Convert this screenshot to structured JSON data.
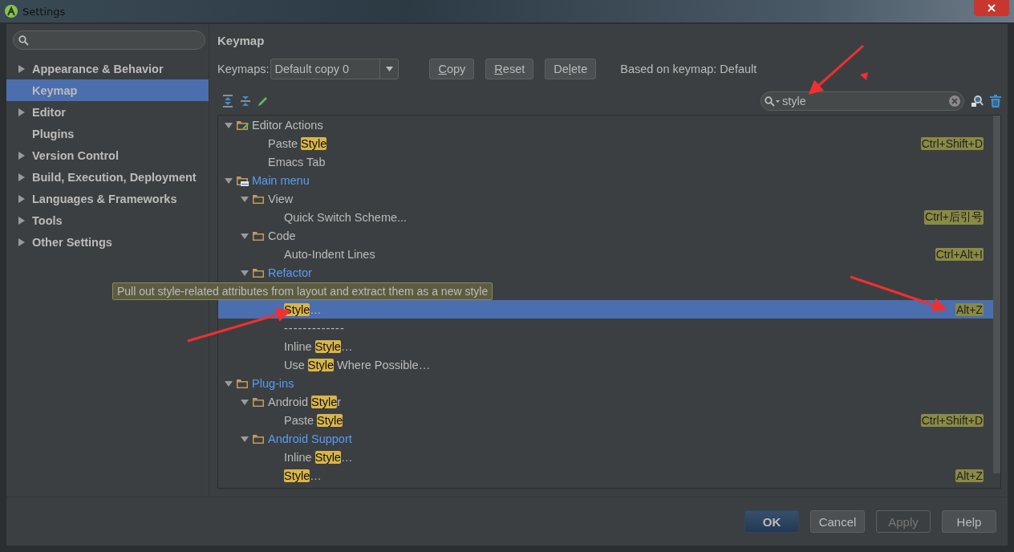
{
  "window": {
    "title": "Settings"
  },
  "sidebar": {
    "items": [
      {
        "label": "Appearance & Behavior",
        "expandable": true,
        "selected": false
      },
      {
        "label": "Keymap",
        "expandable": false,
        "selected": true
      },
      {
        "label": "Editor",
        "expandable": true,
        "selected": false
      },
      {
        "label": "Plugins",
        "expandable": false,
        "selected": false
      },
      {
        "label": "Version Control",
        "expandable": true,
        "selected": false
      },
      {
        "label": "Build, Execution, Deployment",
        "expandable": true,
        "selected": false
      },
      {
        "label": "Languages & Frameworks",
        "expandable": true,
        "selected": false
      },
      {
        "label": "Tools",
        "expandable": true,
        "selected": false
      },
      {
        "label": "Other Settings",
        "expandable": true,
        "selected": false
      }
    ]
  },
  "panel": {
    "title": "Keymap",
    "keymaps_label": "Keymaps:",
    "keymap_value": "Default copy 0",
    "buttons": [
      {
        "parts": [
          {
            "text": "C",
            "underline": true
          },
          {
            "text": "opy",
            "underline": false
          }
        ]
      },
      {
        "parts": [
          {
            "text": "R",
            "underline": true
          },
          {
            "text": "eset",
            "underline": false
          }
        ]
      },
      {
        "parts": [
          {
            "text": "De",
            "underline": false
          },
          {
            "text": "l",
            "underline": true
          },
          {
            "text": "ete",
            "underline": false
          }
        ]
      }
    ],
    "based_on": "Based on keymap: Default",
    "filter": {
      "value": "style"
    }
  },
  "tree": [
    {
      "kind": "editor-group",
      "modified": false,
      "expanded": true,
      "selected": false,
      "parts": [
        {
          "text": "Editor Actions",
          "match": false
        }
      ],
      "children": [
        {
          "kind": "action",
          "selected": false,
          "parts": [
            {
              "text": "Paste ",
              "match": false
            },
            {
              "text": "Style",
              "match": true
            }
          ],
          "shortcut": "Ctrl+Shift+D"
        },
        {
          "kind": "action",
          "selected": false,
          "parts": [
            {
              "text": "Emacs Tab",
              "match": false
            }
          ]
        }
      ]
    },
    {
      "kind": "menu-group",
      "modified": true,
      "expanded": true,
      "selected": false,
      "parts": [
        {
          "text": "Main menu",
          "match": false
        }
      ],
      "children": [
        {
          "kind": "group",
          "modified": false,
          "expanded": true,
          "selected": false,
          "parts": [
            {
              "text": "View",
              "match": false
            }
          ],
          "children": [
            {
              "kind": "action",
              "selected": false,
              "parts": [
                {
                  "text": "Quick Switch Scheme...",
                  "match": false
                }
              ],
              "shortcut": "Ctrl+后引号"
            }
          ]
        },
        {
          "kind": "group",
          "modified": false,
          "expanded": true,
          "selected": false,
          "parts": [
            {
              "text": "Code",
              "match": false
            }
          ],
          "children": [
            {
              "kind": "action",
              "selected": false,
              "parts": [
                {
                  "text": "Auto-Indent Lines",
                  "match": false
                }
              ],
              "shortcut": "Ctrl+Alt+I"
            }
          ]
        },
        {
          "kind": "group",
          "modified": true,
          "expanded": true,
          "selected": false,
          "parts": [
            {
              "text": "Refactor",
              "match": false
            }
          ],
          "children": [
            {
              "kind": "action",
              "selected": true,
              "parts": [
                {
                  "text": "Style",
                  "match": true
                },
                {
                  "text": "…",
                  "match": false
                }
              ],
              "shortcut": "Alt+Z",
              "tooltip": "Pull out style-related attributes from layout and extract them as a new style"
            },
            {
              "kind": "separator",
              "selected": false,
              "parts": [
                {
                  "text": "-------------",
                  "match": false
                }
              ]
            },
            {
              "kind": "action",
              "selected": false,
              "parts": [
                {
                  "text": "Inline ",
                  "match": false
                },
                {
                  "text": "Style",
                  "match": true
                },
                {
                  "text": "…",
                  "match": false
                }
              ]
            },
            {
              "kind": "action",
              "selected": false,
              "parts": [
                {
                  "text": "Use ",
                  "match": false
                },
                {
                  "text": "Style",
                  "match": true
                },
                {
                  "text": " Where Possible…",
                  "match": false
                }
              ]
            }
          ]
        }
      ]
    },
    {
      "kind": "group",
      "modified": true,
      "expanded": true,
      "selected": false,
      "parts": [
        {
          "text": "Plug-ins",
          "match": false
        }
      ],
      "children": [
        {
          "kind": "group",
          "modified": false,
          "expanded": true,
          "selected": false,
          "parts": [
            {
              "text": "Android ",
              "match": false
            },
            {
              "text": "Style",
              "match": true
            },
            {
              "text": "r",
              "match": false
            }
          ],
          "children": [
            {
              "kind": "action",
              "selected": false,
              "parts": [
                {
                  "text": "Paste ",
                  "match": false
                },
                {
                  "text": "Style",
                  "match": true
                }
              ],
              "shortcut": "Ctrl+Shift+D"
            }
          ]
        },
        {
          "kind": "group",
          "modified": true,
          "expanded": true,
          "selected": false,
          "parts": [
            {
              "text": "Android Support",
              "match": false
            }
          ],
          "children": [
            {
              "kind": "action",
              "selected": false,
              "parts": [
                {
                  "text": "Inline ",
                  "match": false
                },
                {
                  "text": "Style",
                  "match": true
                },
                {
                  "text": "…",
                  "match": false
                }
              ]
            },
            {
              "kind": "action",
              "selected": false,
              "parts": [
                {
                  "text": "Style",
                  "match": true
                },
                {
                  "text": "…",
                  "match": false
                }
              ],
              "shortcut": "Alt+Z"
            }
          ]
        }
      ]
    }
  ],
  "footer": {
    "buttons": [
      {
        "label": "OK",
        "default": true,
        "disabled": false
      },
      {
        "label": "Cancel",
        "default": false,
        "disabled": false
      },
      {
        "label": "Apply",
        "default": false,
        "disabled": true
      },
      {
        "label": "Help",
        "default": false,
        "disabled": false
      }
    ]
  }
}
